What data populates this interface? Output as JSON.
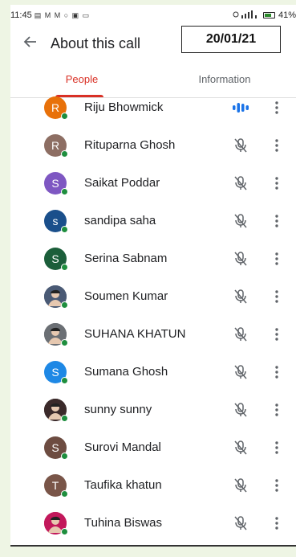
{
  "statusbar": {
    "time": "11:45",
    "notif_icons": "▤ M M ○ ▣ ▭",
    "battery": "41%"
  },
  "appbar": {
    "title": "About this call",
    "date": "20/01/21"
  },
  "tabs": [
    {
      "label": "People",
      "active": true
    },
    {
      "label": "Information",
      "active": false
    }
  ],
  "participants": [
    {
      "name": "Riju Bhowmick",
      "initial": "R",
      "color": "#e8710a",
      "speaking": true,
      "photo": false
    },
    {
      "name": "Rituparna Ghosh",
      "initial": "R",
      "color": "#8d6e63",
      "speaking": false,
      "photo": false
    },
    {
      "name": "Saikat Poddar",
      "initial": "S",
      "color": "#7e57c2",
      "speaking": false,
      "photo": false
    },
    {
      "name": "sandipa saha",
      "initial": "s",
      "color": "#1a4f8b",
      "speaking": false,
      "photo": false
    },
    {
      "name": "Serina Sabnam",
      "initial": "S",
      "color": "#1b5e3a",
      "speaking": false,
      "photo": false
    },
    {
      "name": "Soumen Kumar",
      "initial": "",
      "color": "#4a5a75",
      "speaking": false,
      "photo": true
    },
    {
      "name": "SUHANA KHATUN",
      "initial": "",
      "color": "#6b6f74",
      "speaking": false,
      "photo": true
    },
    {
      "name": "Sumana Ghosh",
      "initial": "S",
      "color": "#1e88e5",
      "speaking": false,
      "photo": false
    },
    {
      "name": "sunny sunny",
      "initial": "",
      "color": "#3b2a2a",
      "speaking": false,
      "photo": true
    },
    {
      "name": "Surovi Mandal",
      "initial": "S",
      "color": "#6d4c41",
      "speaking": false,
      "photo": false
    },
    {
      "name": "Taufika khatun",
      "initial": "T",
      "color": "#795548",
      "speaking": false,
      "photo": false
    },
    {
      "name": "Tuhina Biswas",
      "initial": "",
      "color": "#c2185b",
      "speaking": false,
      "photo": true
    }
  ]
}
